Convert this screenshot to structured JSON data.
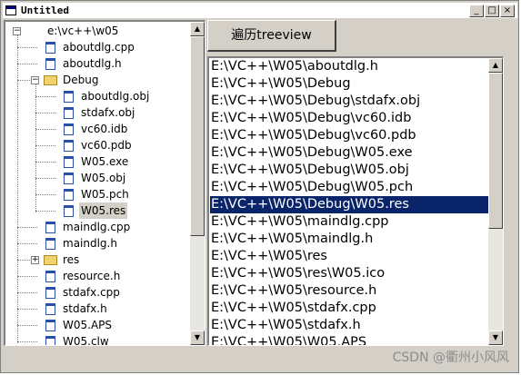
{
  "window": {
    "title": "Untitled"
  },
  "title_buttons": {
    "minimize": "_",
    "maximize": "□",
    "close": "×"
  },
  "tree": {
    "root": "e:\\vc++\\w05",
    "items": [
      {
        "label": "aboutdlg.cpp",
        "type": "file"
      },
      {
        "label": "aboutdlg.h",
        "type": "file"
      },
      {
        "label": "Debug",
        "type": "folder",
        "expanded": true
      },
      {
        "label": "aboutdlg.obj",
        "type": "file"
      },
      {
        "label": "stdafx.obj",
        "type": "file"
      },
      {
        "label": "vc60.idb",
        "type": "file"
      },
      {
        "label": "vc60.pdb",
        "type": "file"
      },
      {
        "label": "W05.exe",
        "type": "file"
      },
      {
        "label": "W05.obj",
        "type": "file"
      },
      {
        "label": "W05.pch",
        "type": "file"
      },
      {
        "label": "W05.res",
        "type": "file",
        "selected": true
      },
      {
        "label": "maindlg.cpp",
        "type": "file"
      },
      {
        "label": "maindlg.h",
        "type": "file"
      },
      {
        "label": "res",
        "type": "folder",
        "expanded": false
      },
      {
        "label": "resource.h",
        "type": "file"
      },
      {
        "label": "stdafx.cpp",
        "type": "file"
      },
      {
        "label": "stdafx.h",
        "type": "file"
      },
      {
        "label": "W05.APS",
        "type": "file"
      },
      {
        "label": "W05.clw",
        "type": "file"
      }
    ],
    "collapse_glyph": "−",
    "expand_glyph": "+"
  },
  "traverse_button": {
    "label": "遍历treeview"
  },
  "list": {
    "items": [
      "E:\\VC++\\W05\\aboutdlg.h",
      "E:\\VC++\\W05\\Debug",
      "E:\\VC++\\W05\\Debug\\stdafx.obj",
      "E:\\VC++\\W05\\Debug\\vc60.idb",
      "E:\\VC++\\W05\\Debug\\vc60.pdb",
      "E:\\VC++\\W05\\Debug\\W05.exe",
      "E:\\VC++\\W05\\Debug\\W05.obj",
      "E:\\VC++\\W05\\Debug\\W05.pch",
      "E:\\VC++\\W05\\Debug\\W05.res",
      "E:\\VC++\\W05\\maindlg.cpp",
      "E:\\VC++\\W05\\maindlg.h",
      "E:\\VC++\\W05\\res",
      "E:\\VC++\\W05\\res\\W05.ico",
      "E:\\VC++\\W05\\resource.h",
      "E:\\VC++\\W05\\stdafx.cpp",
      "E:\\VC++\\W05\\stdafx.h",
      "E:\\VC++\\W05\\W05.APS"
    ],
    "selected_index": 8
  },
  "scroll_glyphs": {
    "up": "▲",
    "down": "▼"
  },
  "watermark": "CSDN @衢州小风风",
  "colors": {
    "selection": "#0a246a",
    "face": "#d4d0c8",
    "folder": "#f2d36b",
    "file_icon": "#2a4fa8"
  }
}
